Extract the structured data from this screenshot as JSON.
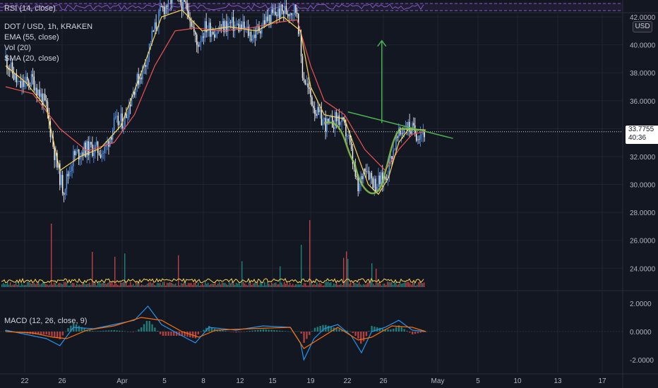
{
  "chart_data": [
    {
      "type": "line",
      "pane": "rsi",
      "legend": "RSI (14, close)",
      "colors": {
        "line": "#7e57c2",
        "band": "#7e57c2"
      }
    },
    {
      "type": "candlestick",
      "pane": "price",
      "legend": {
        "symbol": "DOT / USD, 1h, KRAKEN",
        "ema": "EMA (55, close)",
        "vol": "Vol (20)",
        "sma": "SMA (20, close)"
      },
      "x_ticks": [
        "22",
        "26",
        "Apr",
        "5",
        "8",
        "12",
        "15",
        "19",
        "22",
        "26",
        "May",
        "5",
        "10",
        "13",
        "17"
      ],
      "y_ticks": [
        "42.0000",
        "40.0000",
        "38.0000",
        "36.0000",
        "34.0000",
        "32.0000",
        "30.0000",
        "28.0000",
        "26.0000",
        "24.0000"
      ],
      "ylim": [
        22.6,
        42.0
      ],
      "current_price": "33.7755",
      "countdown": "40:36",
      "currency": "USD",
      "close_series": [
        {
          "x": 0,
          "y": 39.0
        },
        {
          "x": 2,
          "y": 37.0
        },
        {
          "x": 4,
          "y": 37.5
        },
        {
          "x": 6,
          "y": 35.5
        },
        {
          "x": 7.5,
          "y": 31.5
        },
        {
          "x": 8.5,
          "y": 29.6
        },
        {
          "x": 10,
          "y": 32.0
        },
        {
          "x": 11.5,
          "y": 32.5
        },
        {
          "x": 13,
          "y": 32.6
        },
        {
          "x": 14.5,
          "y": 32.3
        },
        {
          "x": 16,
          "y": 34.3
        },
        {
          "x": 17.5,
          "y": 34.6
        },
        {
          "x": 19,
          "y": 37.0
        },
        {
          "x": 20.5,
          "y": 38.5
        },
        {
          "x": 21.5,
          "y": 40.5
        },
        {
          "x": 23,
          "y": 42.5
        },
        {
          "x": 25,
          "y": 43.5
        },
        {
          "x": 27,
          "y": 42.5
        },
        {
          "x": 28.2,
          "y": 40.0
        },
        {
          "x": 29.5,
          "y": 41.3
        },
        {
          "x": 31,
          "y": 41.0
        },
        {
          "x": 33,
          "y": 41.5
        },
        {
          "x": 35,
          "y": 41.2
        },
        {
          "x": 36.5,
          "y": 40.6
        },
        {
          "x": 38,
          "y": 41.6
        },
        {
          "x": 40,
          "y": 42.3
        },
        {
          "x": 42,
          "y": 42.5
        },
        {
          "x": 43,
          "y": 42.5
        },
        {
          "x": 43.8,
          "y": 38.0
        },
        {
          "x": 44.8,
          "y": 36.5
        },
        {
          "x": 46,
          "y": 35.0
        },
        {
          "x": 47.5,
          "y": 34.2
        },
        {
          "x": 49,
          "y": 34.8
        },
        {
          "x": 50.5,
          "y": 33.5
        },
        {
          "x": 52,
          "y": 29.5
        },
        {
          "x": 53,
          "y": 31.5
        },
        {
          "x": 54.5,
          "y": 30.0
        },
        {
          "x": 56,
          "y": 30.5
        },
        {
          "x": 57.5,
          "y": 33.0
        },
        {
          "x": 59,
          "y": 34.3
        },
        {
          "x": 60.5,
          "y": 33.7
        },
        {
          "x": 62,
          "y": 33.8
        }
      ],
      "ema55": [
        {
          "x": 0,
          "y": 37.0
        },
        {
          "x": 4,
          "y": 36.5
        },
        {
          "x": 8,
          "y": 34.0
        },
        {
          "x": 12,
          "y": 32.4
        },
        {
          "x": 16,
          "y": 33.0
        },
        {
          "x": 19,
          "y": 35.0
        },
        {
          "x": 22,
          "y": 38.5
        },
        {
          "x": 25,
          "y": 41.0
        },
        {
          "x": 28,
          "y": 41.2
        },
        {
          "x": 32,
          "y": 41.0
        },
        {
          "x": 36,
          "y": 41.2
        },
        {
          "x": 40,
          "y": 41.6
        },
        {
          "x": 43,
          "y": 41.8
        },
        {
          "x": 45,
          "y": 38.5
        },
        {
          "x": 47,
          "y": 36.0
        },
        {
          "x": 50,
          "y": 35.0
        },
        {
          "x": 53,
          "y": 32.5
        },
        {
          "x": 56,
          "y": 31.0
        },
        {
          "x": 58,
          "y": 32.5
        },
        {
          "x": 60,
          "y": 33.6
        },
        {
          "x": 62,
          "y": 33.8
        }
      ],
      "sma20": [
        {
          "x": 0,
          "y": 38.5
        },
        {
          "x": 3,
          "y": 37.3
        },
        {
          "x": 6,
          "y": 35.5
        },
        {
          "x": 8,
          "y": 31.0
        },
        {
          "x": 11,
          "y": 32.0
        },
        {
          "x": 14,
          "y": 32.6
        },
        {
          "x": 17,
          "y": 34.2
        },
        {
          "x": 20,
          "y": 38.0
        },
        {
          "x": 23,
          "y": 42.0
        },
        {
          "x": 26,
          "y": 42.5
        },
        {
          "x": 29,
          "y": 41.0
        },
        {
          "x": 33,
          "y": 41.3
        },
        {
          "x": 37,
          "y": 41.0
        },
        {
          "x": 41,
          "y": 42.0
        },
        {
          "x": 43.5,
          "y": 41.0
        },
        {
          "x": 45,
          "y": 37.0
        },
        {
          "x": 47,
          "y": 35.0
        },
        {
          "x": 50,
          "y": 34.7
        },
        {
          "x": 52,
          "y": 32.0
        },
        {
          "x": 53.5,
          "y": 30.0
        },
        {
          "x": 55,
          "y": 29.3
        },
        {
          "x": 56.5,
          "y": 30.5
        },
        {
          "x": 58,
          "y": 33.0
        },
        {
          "x": 59.5,
          "y": 34.0
        },
        {
          "x": 62,
          "y": 33.9
        }
      ],
      "annotations": {
        "trend_line": {
          "start": {
            "x": 50.5,
            "y": 35.2
          },
          "end": {
            "x": 66,
            "y": 33.3
          },
          "color": "#4caf50"
        },
        "target_arrow": {
          "x": 55.5,
          "bottom": 34.4,
          "top": 40.3,
          "color": "#4caf50"
        },
        "cup_curve": {
          "color": "#8bc34a"
        }
      },
      "colors": {
        "up": "#5b9cf6",
        "down": "#ffffff",
        "ema": "#ef5350",
        "sma": "#ffd54f",
        "volume": "#ffd54f"
      }
    },
    {
      "type": "line",
      "pane": "macd",
      "legend": "MACD (12, 26, close, 9)",
      "y_ticks": [
        "2.0000",
        "0.0000",
        "-2.0000"
      ],
      "ylim": [
        -2.5,
        2.5
      ],
      "macd": [
        {
          "x": 0,
          "y": 0.1
        },
        {
          "x": 3,
          "y": -0.2
        },
        {
          "x": 6,
          "y": -0.5
        },
        {
          "x": 8,
          "y": -1.0
        },
        {
          "x": 10,
          "y": 0.3
        },
        {
          "x": 13,
          "y": 0.2
        },
        {
          "x": 16,
          "y": 0.5
        },
        {
          "x": 19,
          "y": 0.8
        },
        {
          "x": 21,
          "y": 1.8
        },
        {
          "x": 23,
          "y": 0.5
        },
        {
          "x": 26,
          "y": -0.3
        },
        {
          "x": 28,
          "y": -0.8
        },
        {
          "x": 30,
          "y": 0.3
        },
        {
          "x": 34,
          "y": 0.1
        },
        {
          "x": 38,
          "y": 0.4
        },
        {
          "x": 42,
          "y": 0.3
        },
        {
          "x": 43.5,
          "y": -0.8
        },
        {
          "x": 44,
          "y": -2.0
        },
        {
          "x": 45.5,
          "y": -0.5
        },
        {
          "x": 47,
          "y": 0.2
        },
        {
          "x": 49,
          "y": 0.5
        },
        {
          "x": 51,
          "y": -0.3
        },
        {
          "x": 52.5,
          "y": -1.5
        },
        {
          "x": 54,
          "y": 0.0
        },
        {
          "x": 56,
          "y": 0.3
        },
        {
          "x": 58,
          "y": 0.8
        },
        {
          "x": 60,
          "y": 0.1
        },
        {
          "x": 62,
          "y": 0.0
        }
      ],
      "signal": [
        {
          "x": 0,
          "y": 0.0
        },
        {
          "x": 4,
          "y": -0.1
        },
        {
          "x": 7,
          "y": -0.4
        },
        {
          "x": 9,
          "y": -0.5
        },
        {
          "x": 12,
          "y": 0.1
        },
        {
          "x": 16,
          "y": 0.4
        },
        {
          "x": 20,
          "y": 1.0
        },
        {
          "x": 23,
          "y": 0.8
        },
        {
          "x": 26,
          "y": 0.0
        },
        {
          "x": 28.5,
          "y": -0.4
        },
        {
          "x": 31,
          "y": 0.1
        },
        {
          "x": 36,
          "y": 0.2
        },
        {
          "x": 42,
          "y": 0.3
        },
        {
          "x": 44,
          "y": -1.2
        },
        {
          "x": 46,
          "y": -0.6
        },
        {
          "x": 49,
          "y": 0.3
        },
        {
          "x": 52,
          "y": -0.6
        },
        {
          "x": 54,
          "y": -0.4
        },
        {
          "x": 57,
          "y": 0.4
        },
        {
          "x": 60,
          "y": 0.3
        },
        {
          "x": 62,
          "y": 0.0
        }
      ],
      "colors": {
        "macd": "#2196f3",
        "signal": "#ff6d00",
        "hist_up": "#26a69a",
        "hist_down": "#ef5350"
      }
    }
  ]
}
